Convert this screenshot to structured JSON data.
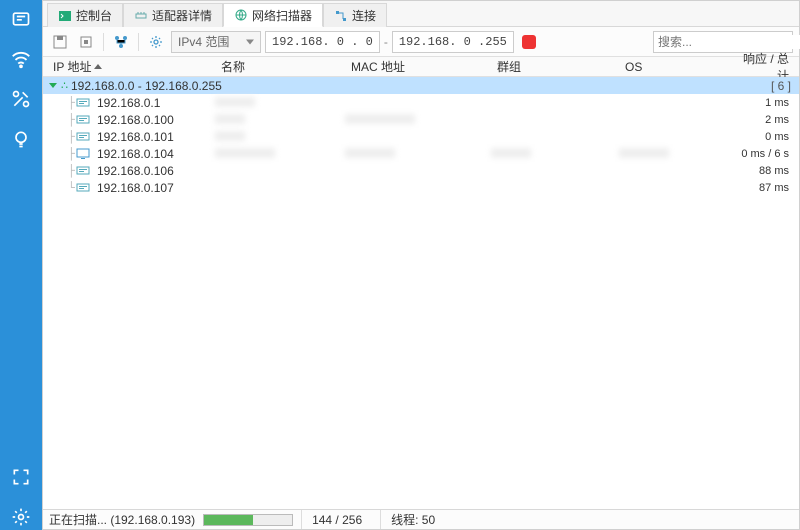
{
  "tabs": [
    {
      "label": "控制台"
    },
    {
      "label": "适配器详情"
    },
    {
      "label": "网络扫描器"
    },
    {
      "label": "连接"
    }
  ],
  "active_tab": 2,
  "toolbar": {
    "range_select": "IPv4 范围",
    "ip_from": "192.168. 0 . 0",
    "ip_to": "192.168. 0 .255",
    "search_placeholder": "搜索..."
  },
  "columns": {
    "ip": "IP 地址",
    "name": "名称",
    "mac": "MAC 地址",
    "group": "群组",
    "os": "OS",
    "resp": "响应 / 总计"
  },
  "group": {
    "label": "192.168.0.0 - 192.168.0.255",
    "count": "[ 6 ]"
  },
  "rows": [
    {
      "ip": "192.168.0.1",
      "resp": "1 ms",
      "blur_name": 40,
      "blur_mac": 0,
      "type": "host"
    },
    {
      "ip": "192.168.0.100",
      "resp": "2 ms",
      "blur_name": 30,
      "blur_mac": 70,
      "type": "host"
    },
    {
      "ip": "192.168.0.101",
      "resp": "0 ms",
      "blur_name": 30,
      "blur_mac": 0,
      "type": "host"
    },
    {
      "ip": "192.168.0.104",
      "resp": "0 ms / 6 s",
      "blur_name": 60,
      "blur_mac": 50,
      "blur_group": 40,
      "blur_os": 50,
      "type": "pc"
    },
    {
      "ip": "192.168.0.106",
      "resp": "88 ms",
      "blur_name": 0,
      "blur_mac": 0,
      "type": "host"
    },
    {
      "ip": "192.168.0.107",
      "resp": "87 ms",
      "blur_name": 0,
      "blur_mac": 0,
      "type": "host"
    }
  ],
  "status": {
    "scanning": "正在扫描... (192.168.0.193)",
    "progress_frac": "144 / 256",
    "progress_pct": 56,
    "threads": "线程: 50"
  }
}
